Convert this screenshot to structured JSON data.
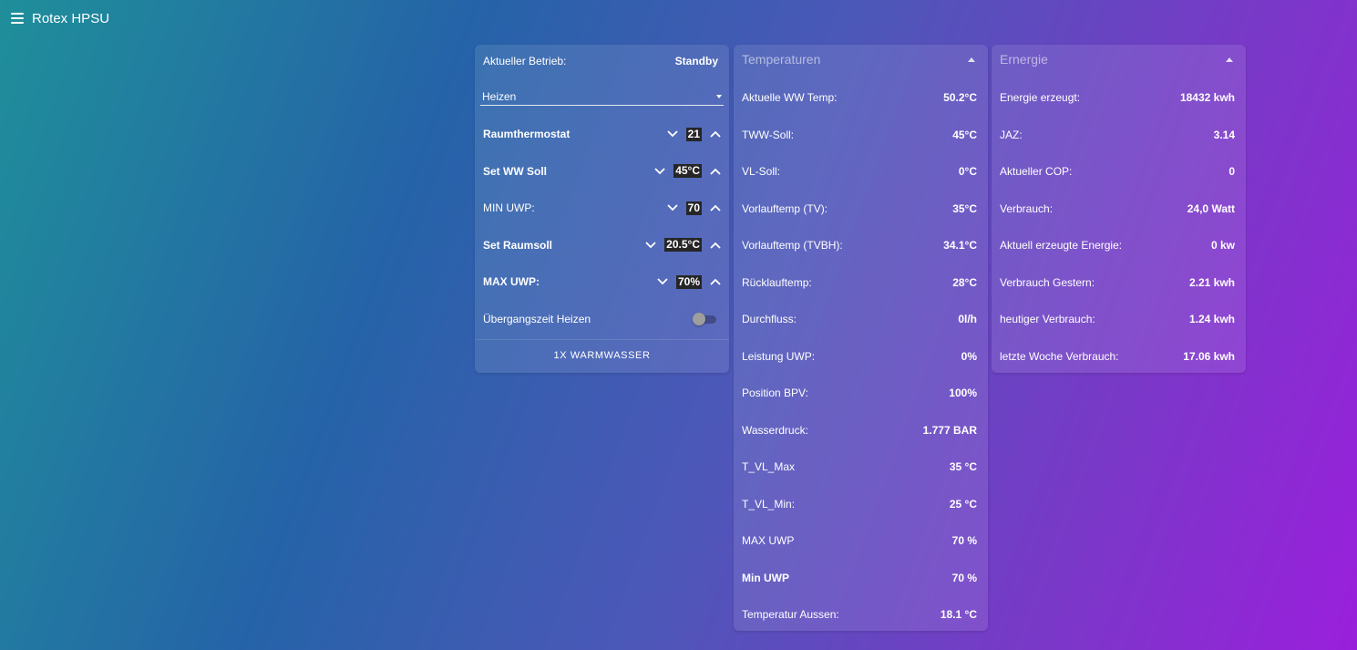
{
  "app": {
    "title": "Rotex HPSU"
  },
  "controls": {
    "status_label": "Aktueller Betrieb:",
    "status_value": "Standby",
    "mode_select": "Heizen",
    "numbers": [
      {
        "label": "Raumthermostat",
        "value": "21",
        "bold": true
      },
      {
        "label": "Set WW Soll",
        "value": "45°C",
        "bold": true
      },
      {
        "label": "MIN UWP:",
        "value": "70",
        "bold": false
      },
      {
        "label": "Set Raumsoll",
        "value": "20.5°C",
        "bold": true
      },
      {
        "label": "MAX UWP:",
        "value": "70%",
        "bold": true
      }
    ],
    "toggle_label": "Übergangszeit Heizen",
    "toggle_on": false,
    "action_label": "1X WARMWASSER"
  },
  "temps": {
    "title": "Temperaturen",
    "rows": [
      {
        "label": "Aktuelle WW Temp:",
        "value": "50.2°C"
      },
      {
        "label": "TWW-Soll:",
        "value": "45°C"
      },
      {
        "label": "VL-Soll:",
        "value": "0°C"
      },
      {
        "label": "Vorlauftemp (TV):",
        "value": "35°C"
      },
      {
        "label": "Vorlauftemp (TVBH):",
        "value": "34.1°C"
      },
      {
        "label": "Rücklauftemp:",
        "value": "28°C"
      },
      {
        "label": "Durchfluss:",
        "value": "0l/h"
      },
      {
        "label": "Leistung UWP:",
        "value": "0%"
      },
      {
        "label": "Position BPV:",
        "value": "100%"
      },
      {
        "label": "Wasserdruck:",
        "value": "1.777 BAR"
      },
      {
        "label": "T_VL_Max",
        "value": "35 °C"
      },
      {
        "label": "T_VL_Min:",
        "value": "25 °C"
      },
      {
        "label": "MAX UWP",
        "value": "70 %"
      },
      {
        "label": "Min UWP",
        "value": "70 %",
        "bold": true
      },
      {
        "label": "Temperatur Aussen:",
        "value": "18.1 °C"
      }
    ]
  },
  "energy": {
    "title": "Ernergie",
    "rows": [
      {
        "label": "Energie erzeugt:",
        "value": "18432 kwh"
      },
      {
        "label": "JAZ:",
        "value": "3.14"
      },
      {
        "label": "Aktueller COP:",
        "value": "0"
      },
      {
        "label": "Verbrauch:",
        "value": "24,0 Watt"
      },
      {
        "label": "Aktuell erzeugte Energie:",
        "value": "0 kw"
      },
      {
        "label": "Verbrauch Gestern:",
        "value": "2.21 kwh"
      },
      {
        "label": "heutiger Verbrauch:",
        "value": "1.24 kwh"
      },
      {
        "label": "letzte Woche Verbrauch:",
        "value": "17.06 kwh"
      }
    ]
  }
}
